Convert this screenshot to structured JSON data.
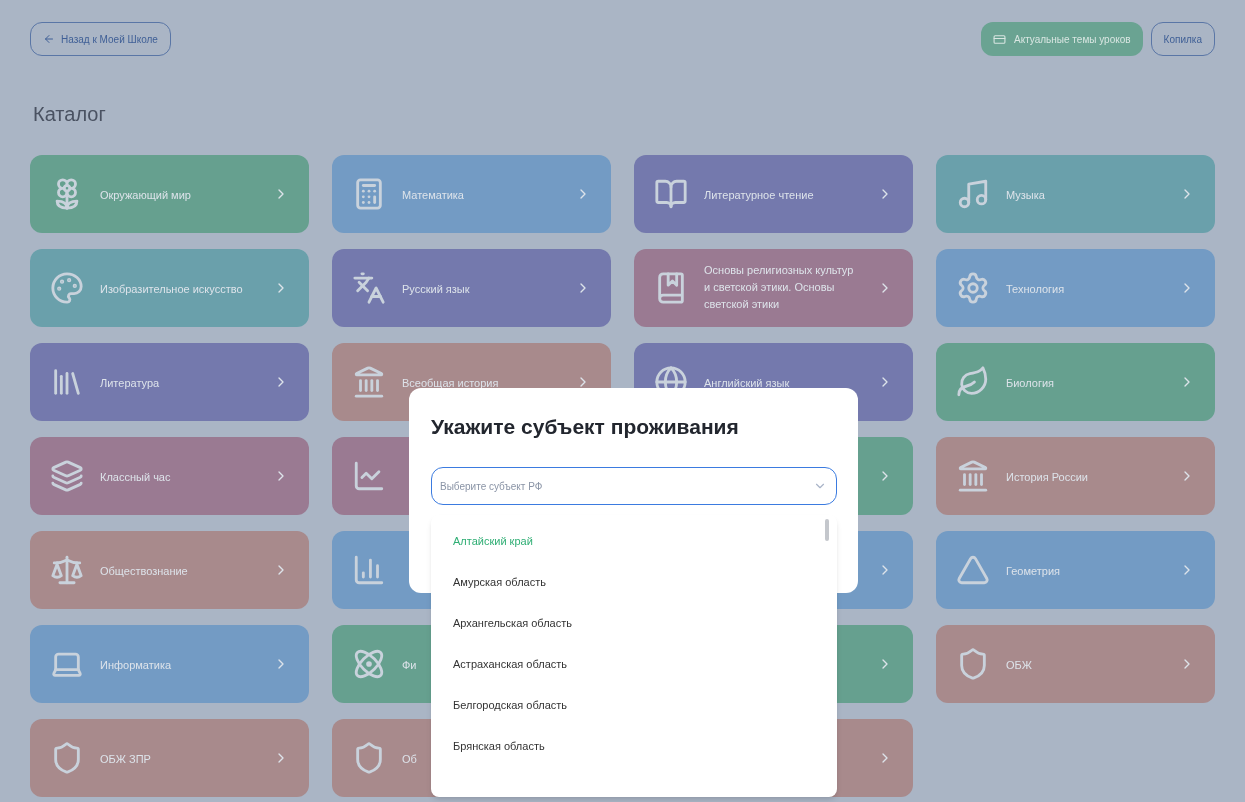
{
  "header": {
    "back_button": "Назад к Моей Школе",
    "topics_button": "Актуальные темы уроков",
    "piggy_button": "Копилка"
  },
  "title": "Каталог",
  "cards": [
    {
      "label": "Окружающий мир",
      "color": "#66a08f"
    },
    {
      "label": "Математика",
      "color": "#739bc4"
    },
    {
      "label": "Литературное чтение",
      "color": "#7479ad"
    },
    {
      "label": "Музыка",
      "color": "#6aa0ab"
    },
    {
      "label": "Изобразительное искусство",
      "color": "#6aa0ab"
    },
    {
      "label": "Русский язык",
      "color": "#7479ad"
    },
    {
      "label": "Основы религиозных культур и светской этики. Основы светской этики",
      "color": "#9a7a92"
    },
    {
      "label": "Технология",
      "color": "#739bc4"
    },
    {
      "label": "Литература",
      "color": "#7479ad"
    },
    {
      "label": "Всеобщая история",
      "color": "#a88a8c"
    },
    {
      "label": "Английский язык",
      "color": "#7479ad"
    },
    {
      "label": "Биология",
      "color": "#66a08f"
    },
    {
      "label": "Классный час",
      "color": "#9a7a92"
    },
    {
      "color": "#9a7a92"
    },
    {
      "color": "#66a08f"
    },
    {
      "label": "История России",
      "color": "#a88a8c"
    },
    {
      "label": "Обществознание",
      "color": "#a88a8c"
    },
    {
      "color": "#739bc4"
    },
    {
      "color": "#739bc4"
    },
    {
      "label": "Геометрия",
      "color": "#739bc4"
    },
    {
      "label": "Информатика",
      "color": "#739bc4"
    },
    {
      "label": "Фи",
      "color": "#66a08f"
    },
    {
      "color": "#66a08f"
    },
    {
      "label": "ОБЖ",
      "color": "#a88a8c"
    },
    {
      "label": "ОБЖ ЗПР",
      "color": "#a88a8c"
    },
    {
      "label": "Об",
      "color": "#a88a8c"
    },
    {
      "color": "#a88a8c"
    }
  ],
  "modal": {
    "title": "Укажите субъект проживания",
    "select": {
      "placeholder": "Выберите субъект РФ"
    },
    "options": [
      {
        "label": "Алтайский край",
        "selected": true
      },
      {
        "label": "Амурская область",
        "selected": false
      },
      {
        "label": "Архангельская область",
        "selected": false
      },
      {
        "label": "Астраханская область",
        "selected": false
      },
      {
        "label": "Белгородская область",
        "selected": false
      },
      {
        "label": "Брянская область",
        "selected": false
      }
    ]
  }
}
